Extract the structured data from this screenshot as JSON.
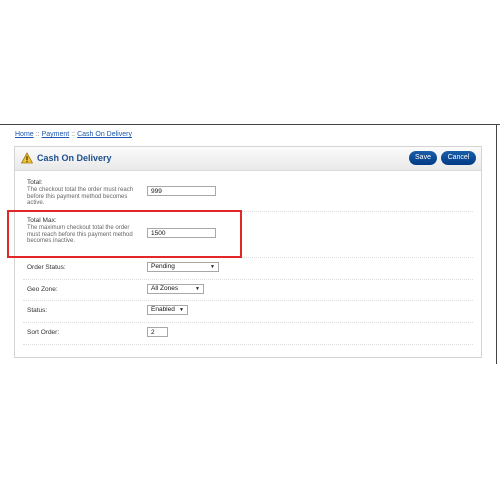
{
  "breadcrumb": {
    "home": "Home",
    "payment": "Payment",
    "current": "Cash On Delivery",
    "separator": "::"
  },
  "header": {
    "title": "Cash On Delivery",
    "save_label": "Save",
    "cancel_label": "Cancel"
  },
  "form": {
    "total": {
      "label": "Total:",
      "help": "The checkout total the order must reach before this payment method becomes active.",
      "value": "999"
    },
    "total_max": {
      "label": "Total Max:",
      "help": "The maximum checkout total the order must reach before this payment method becomes inactive.",
      "value": "1500"
    },
    "order_status": {
      "label": "Order Status:",
      "value": "Pending"
    },
    "geo_zone": {
      "label": "Geo Zone:",
      "value": "All Zones"
    },
    "status": {
      "label": "Status:",
      "value": "Enabled"
    },
    "sort_order": {
      "label": "Sort Order:",
      "value": "2"
    }
  },
  "colors": {
    "accent": "#003a84",
    "title": "#1d4f8f",
    "highlight": "#e32626"
  },
  "icons": {
    "header": "warning-icon",
    "dropdown": "chevron-down-icon"
  }
}
